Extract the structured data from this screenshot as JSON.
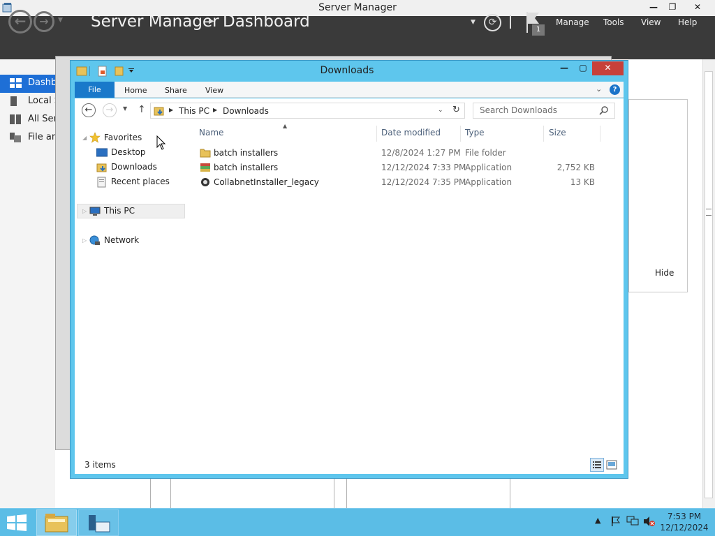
{
  "server_manager": {
    "window_title": "Server Manager",
    "title_controls": {
      "minimize": "—",
      "restore": "❐",
      "close": "✕"
    },
    "breadcrumb_root": "Server Manager",
    "breadcrumb_page": "Dashboard",
    "notification_count": "1",
    "menu": [
      "Manage",
      "Tools",
      "View",
      "Help"
    ],
    "sidebar": [
      {
        "label": "Dashboard",
        "icon": "dashboard-icon"
      },
      {
        "label": "Local Server",
        "icon": "server-icon"
      },
      {
        "label": "All Servers",
        "icon": "servers-icon"
      },
      {
        "label": "File and Storage Services",
        "icon": "storage-icon"
      }
    ],
    "tile_hide": "Hide"
  },
  "explorer": {
    "title": "Downloads",
    "ribbon_tabs": {
      "file": "File",
      "home": "Home",
      "share": "Share",
      "view": "View"
    },
    "help_label": "?",
    "address": {
      "crumbs": [
        "This PC",
        "Downloads"
      ]
    },
    "search_placeholder": "Search Downloads",
    "nav": {
      "favorites": "Favorites",
      "favorites_items": [
        "Desktop",
        "Downloads",
        "Recent places"
      ],
      "this_pc": "This PC",
      "network": "Network"
    },
    "columns": [
      "Name",
      "Date modified",
      "Type",
      "Size"
    ],
    "files": [
      {
        "name": "batch installers",
        "date": "12/8/2024 1:27 PM",
        "type": "File folder",
        "size": "",
        "icon": "folder-icon"
      },
      {
        "name": "batch installers",
        "date": "12/12/2024 7:33 PM",
        "type": "Application",
        "size": "2,752 KB",
        "icon": "application-icon"
      },
      {
        "name": "CollabnetInstaller_legacy",
        "date": "12/12/2024 7:35 PM",
        "type": "Application",
        "size": "13 KB",
        "icon": "installer-icon"
      }
    ],
    "status": "3 items"
  },
  "taskbar": {
    "time": "7:53 PM",
    "date": "12/12/2024"
  },
  "colors": {
    "accent_blue": "#1979ca",
    "window_frame": "#5ec6ed",
    "taskbar": "#5bbde6",
    "sm_header": "#3a3a3a",
    "close_red": "#c7403a"
  }
}
